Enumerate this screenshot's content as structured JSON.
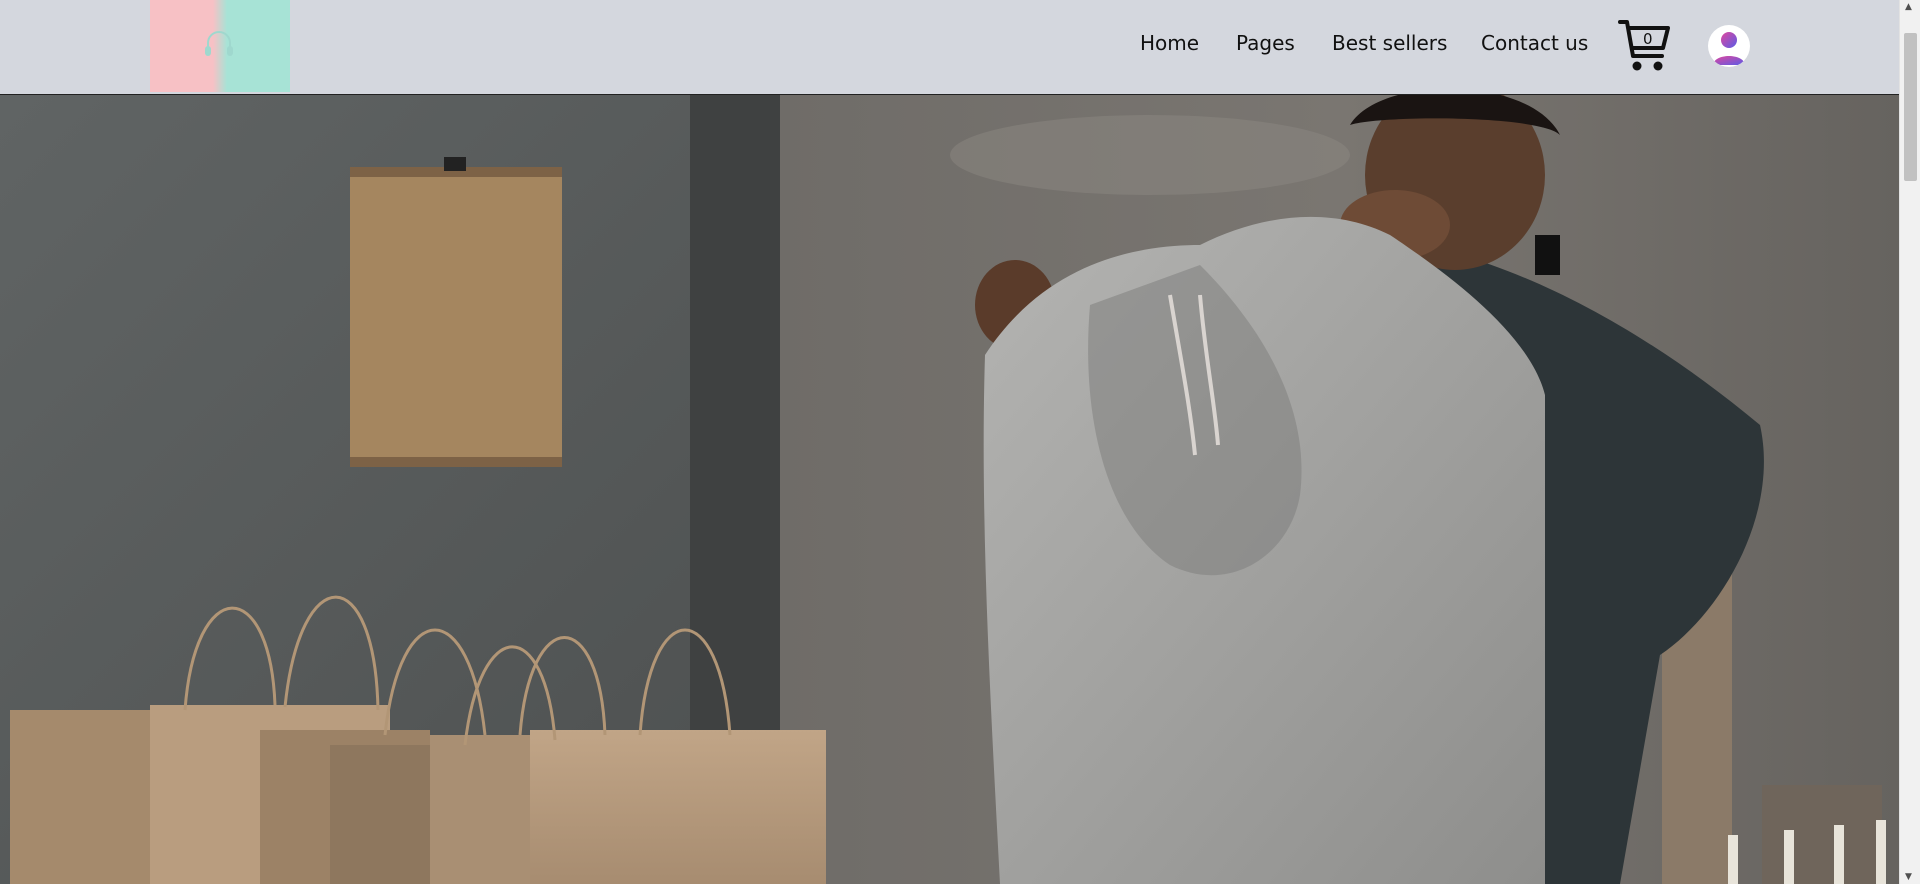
{
  "header": {
    "logo_icon": "headphones-icon",
    "nav": [
      {
        "label": "Home"
      },
      {
        "label": "Pages"
      },
      {
        "label": "Best sellers"
      },
      {
        "label": "Contact us"
      }
    ],
    "cart": {
      "icon": "cart-icon",
      "count": "0"
    },
    "user": {
      "icon": "user-avatar-icon"
    }
  },
  "hero": {
    "image": "man-holding-grey-hoodie-with-paper-bags"
  },
  "colors": {
    "navbar_bg": "#d4d7de",
    "logo_pink": "#f7c1c5",
    "logo_mint": "#a7e3d6",
    "avatar_gradient_start": "#e0479e",
    "avatar_gradient_end": "#5b5be6"
  },
  "scrollbar": {
    "up_glyph": "▲",
    "down_glyph": "▼"
  }
}
